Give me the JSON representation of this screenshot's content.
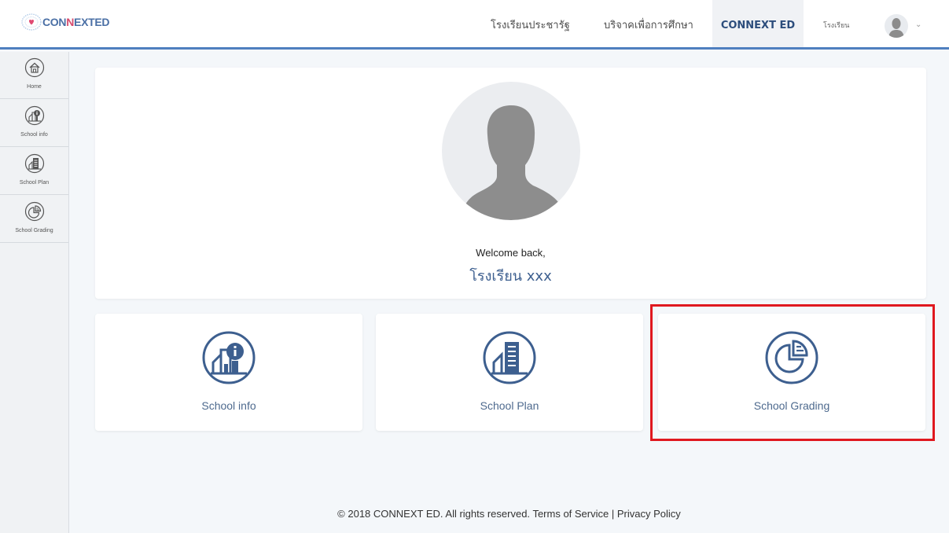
{
  "header": {
    "logo": {
      "part1": "CON",
      "part2": "N",
      "part3": "EXTED"
    },
    "nav": [
      {
        "label": "โรงเรียนประชารัฐ"
      },
      {
        "label": "บริจาคเพื่อการศึกษา"
      },
      {
        "label": "CONNEXT ED"
      },
      {
        "label": "โรงเรียน"
      }
    ]
  },
  "sidebar": {
    "items": [
      {
        "label": "Home",
        "icon": "home-icon"
      },
      {
        "label": "School info",
        "icon": "school-info-icon"
      },
      {
        "label": "School Plan",
        "icon": "school-plan-icon"
      },
      {
        "label": "School Grading",
        "icon": "school-grading-icon"
      }
    ]
  },
  "welcome": {
    "greeting": "Welcome back,",
    "school_name": "โรงเรียน xxx"
  },
  "tiles": [
    {
      "label": "School info",
      "icon": "school-info-icon"
    },
    {
      "label": "School Plan",
      "icon": "school-plan-icon"
    },
    {
      "label": "School Grading",
      "icon": "school-grading-icon"
    }
  ],
  "footer": {
    "copyright": "© 2018 CONNEXT ED. All rights reserved.",
    "terms": "Terms of Service",
    "separator": "|",
    "privacy": "Privacy Policy"
  },
  "colors": {
    "accent": "#4f7fbf",
    "icon": "#3d5f8f",
    "highlight": "#e0181f"
  }
}
